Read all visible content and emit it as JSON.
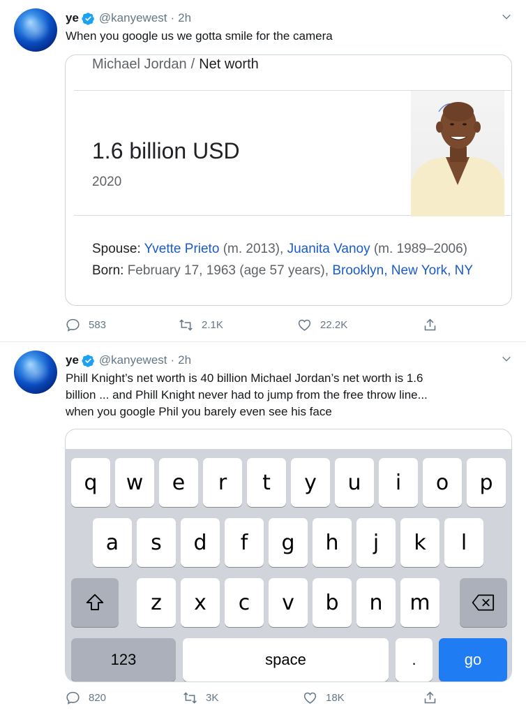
{
  "tweets": [
    {
      "name": "ye",
      "handle": "@kanyewest",
      "time": "2h",
      "text": "When you google us we gotta smile for the camera",
      "card": {
        "breadcrumb_subject": "Michael Jordan",
        "breadcrumb_sep": "/",
        "breadcrumb_current": "Net worth",
        "net_worth": "1.6 billion USD",
        "year": "2020",
        "spouse_label": "Spouse:",
        "spouse1": "Yvette Prieto",
        "spouse1_note": "(m. 2013),",
        "spouse2": "Juanita Vanoy",
        "spouse2_note": "(m. 1989–2006)",
        "born_label": "Born:",
        "born_value": "February 17, 1963 (age 57 years),",
        "born_place": "Brooklyn, New York, NY"
      },
      "replies": "583",
      "retweets": "2.1K",
      "likes": "22.2K"
    },
    {
      "name": "ye",
      "handle": "@kanyewest",
      "time": "2h",
      "text_lines": [
        "Phill Knight’s net worth is 40 billion Michael Jordan’s net worth is 1.6",
        "billion ... and Phill Knight never had to jump from the free throw line...",
        "when you google Phil you barely even see his face"
      ],
      "keyboard": {
        "row1": [
          "q",
          "w",
          "e",
          "r",
          "t",
          "y",
          "u",
          "i",
          "o",
          "p"
        ],
        "row2": [
          "a",
          "s",
          "d",
          "f",
          "g",
          "h",
          "j",
          "k",
          "l"
        ],
        "row3": [
          "z",
          "x",
          "c",
          "v",
          "b",
          "n",
          "m"
        ],
        "numbers_label": "123",
        "space_label": "space",
        "period_label": ".",
        "go_label": "go"
      },
      "replies": "820",
      "retweets": "3K",
      "likes": "18K"
    }
  ],
  "colors": {
    "verified": "#1da1f2",
    "secondary_text": "#657786",
    "link": "#1a5ac9",
    "go_key": "#1f7cf2"
  },
  "icons": [
    "verified-badge-icon",
    "chevron-down-icon",
    "reply-icon",
    "retweet-icon",
    "like-icon",
    "share-icon",
    "shift-icon",
    "backspace-icon"
  ]
}
